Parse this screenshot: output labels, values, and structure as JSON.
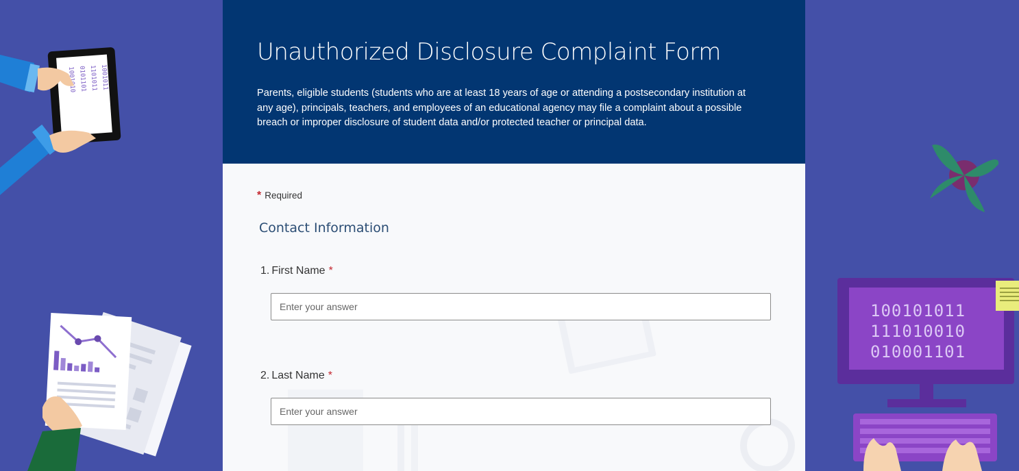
{
  "form": {
    "title": "Unauthorized Disclosure Complaint Form",
    "description": "Parents, eligible students (students who are at least 18 years of age or attending a postsecondary institution at any age), principals, teachers, and employees of an educational agency may file a complaint about a possible breach or improper disclosure of student data and/or protected teacher or principal data.",
    "required_marker": "*",
    "required_label": "Required",
    "section_title": "Contact Information",
    "questions": [
      {
        "number": "1.",
        "label": "First Name",
        "required_marker": "*",
        "placeholder": "Enter your answer"
      },
      {
        "number": "2.",
        "label": "Last Name",
        "required_marker": "*",
        "placeholder": "Enter your answer"
      }
    ]
  },
  "illustrations": {
    "left": [
      "tablet-illustration",
      "hands-illustration",
      "chart-documents-illustration"
    ],
    "right": [
      "leaf-decoration-icon",
      "computer-monitor-illustration",
      "sticky-note-icon",
      "keyboard-illustration"
    ],
    "binary_rows": [
      "100101011",
      "111010010",
      "010001101"
    ]
  },
  "colors": {
    "background": "#4450a8",
    "header": "#023672",
    "card": "#f8f9fb",
    "required": "#c4262e",
    "section_title": "#2b4d74"
  }
}
